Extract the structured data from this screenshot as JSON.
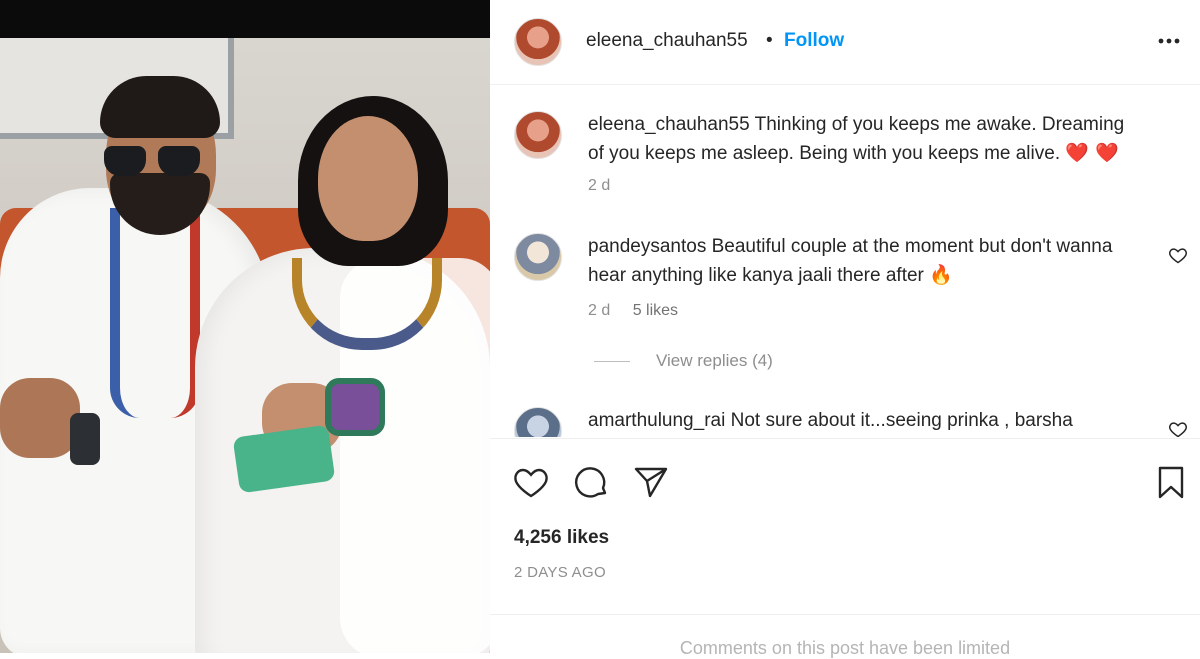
{
  "post": {
    "author": "eleena_chauhan55",
    "dot": "•",
    "follow_label": "Follow",
    "caption": {
      "user": "eleena_chauhan55",
      "text": "Thinking of you keeps me awake. Dreaming of you keeps me asleep. Being with you keeps me alive.",
      "emoji": "❤️ ❤️",
      "age": "2 d"
    },
    "likes_text": "4,256 likes",
    "posted_ago": "2 DAYS AGO",
    "limited_text": "Comments on this post have been limited"
  },
  "comments": [
    {
      "user": "pandeysantos",
      "text": "Beautiful couple at the moment but don't wanna hear anything like kanya jaali there after",
      "emoji": "🔥",
      "age": "2 d",
      "likes": "5 likes",
      "replies_label": "View replies (4)"
    },
    {
      "user": "amarthulung_rai",
      "text": "Not sure about it...seeing prinka , barsha"
    }
  ],
  "icons": {
    "more": "more-horizontal-icon",
    "like": "heart-icon",
    "comment": "comment-bubble-icon",
    "share": "paper-plane-icon",
    "save": "bookmark-icon"
  },
  "colors": {
    "follow": "#0095f6",
    "meta": "#8e8e8e",
    "text": "#262626"
  }
}
